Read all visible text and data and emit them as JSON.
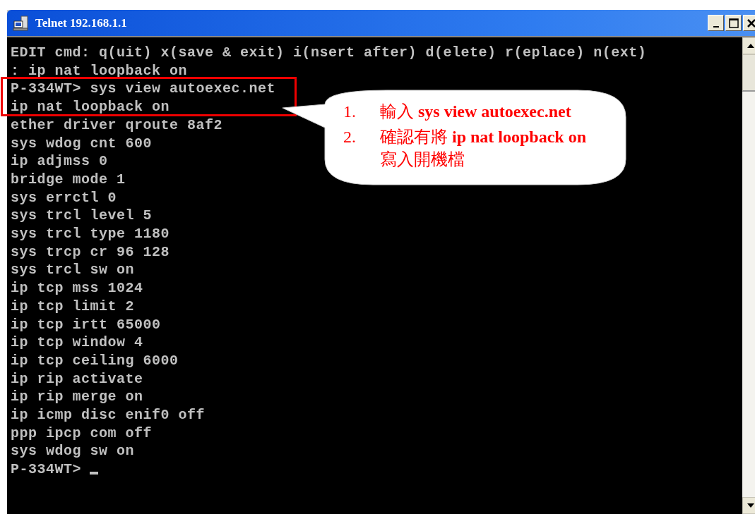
{
  "window": {
    "title": "Telnet 192.168.1.1"
  },
  "terminal": {
    "lines": [
      "EDIT cmd: q(uit) x(save & exit) i(nsert after) d(elete) r(eplace) n(ext)",
      ": ip nat loopback on",
      "P-334WT> sys view autoexec.net",
      "ip nat loopback on",
      "ether driver qroute 8af2",
      "sys wdog cnt 600",
      "ip adjmss 0",
      "bridge mode 1",
      "sys errctl 0",
      "sys trcl level 5",
      "sys trcl type 1180",
      "sys trcp cr 96 128",
      "sys trcl sw on",
      "ip tcp mss 1024",
      "ip tcp limit 2",
      "ip tcp irtt 65000",
      "ip tcp window 4",
      "ip tcp ceiling 6000",
      "ip rip activate",
      "ip rip merge on",
      "ip icmp disc enif0 off",
      "ppp ipcp com off",
      "sys wdog sw on"
    ],
    "prompt": "P-334WT>"
  },
  "callout": {
    "items": [
      {
        "number": "1.",
        "text": "輸入 **sys view autoexec.net**"
      },
      {
        "number": "2.",
        "text": "確認有將 **ip nat loopback on** 寫入開機檔"
      }
    ]
  }
}
